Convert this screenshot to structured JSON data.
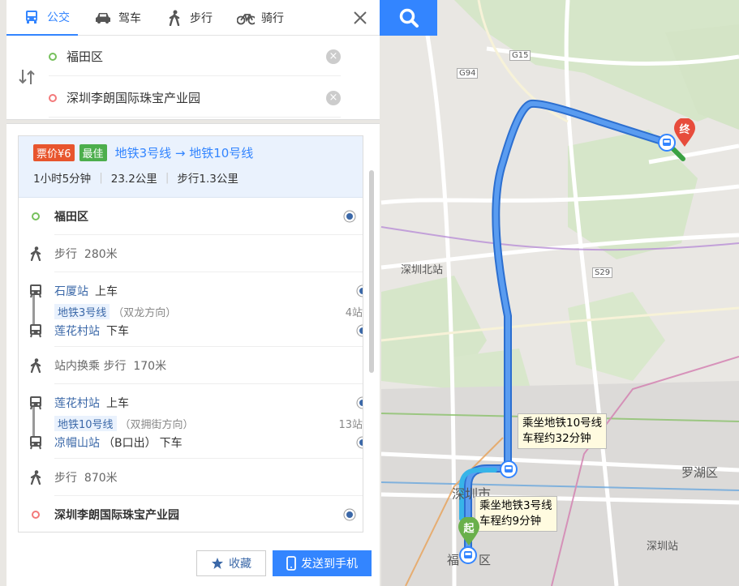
{
  "modes": [
    {
      "label": "公交",
      "icon": "bus-icon",
      "active": true
    },
    {
      "label": "驾车",
      "icon": "car-icon",
      "active": false
    },
    {
      "label": "步行",
      "icon": "walk-icon",
      "active": false
    },
    {
      "label": "骑行",
      "icon": "bike-icon",
      "active": false
    }
  ],
  "inputs": {
    "start": "福田区",
    "end": "深圳李朗国际珠宝产业园"
  },
  "summary": {
    "price_badge": "票价¥6",
    "best_badge": "最佳",
    "title": "地铁3号线 → 地铁10号线",
    "duration": "1小时5分钟",
    "distance": "23.2公里",
    "walk": "步行1.3公里"
  },
  "steps": {
    "start_name": "福田区",
    "walk1": "步行",
    "walk1_dist": "280米",
    "bus1": {
      "board_station": "石厦站",
      "board_action": "上车",
      "line": "地铁3号线",
      "direction": "（双龙方向）",
      "stops": "4站",
      "alight_station": "莲花村站",
      "alight_action": "下车"
    },
    "transfer": "站内换乘",
    "transfer_walk": "步行",
    "transfer_dist": "170米",
    "bus2": {
      "board_station": "莲花村站",
      "board_action": "上车",
      "line": "地铁10号线",
      "direction": "（双拥街方向）",
      "stops": "13站",
      "alight_station": "凉帽山站",
      "alight_exit": "（B口出）",
      "alight_action": "下车"
    },
    "walk2": "步行",
    "walk2_dist": "870米",
    "end_name": "深圳李朗国际珠宝产业园"
  },
  "buttons": {
    "favorite": "收藏",
    "send_phone": "发送到手机"
  },
  "map": {
    "labels": {
      "north_station": "深圳北站",
      "city": "深圳市",
      "luohu": "罗湖区",
      "shenzhen_station": "深圳站",
      "futian_partial": "福",
      "futian_partial2": "区",
      "g15": "G15",
      "g94": "G94",
      "s29": "S29"
    },
    "tip1": [
      "乘坐地铁10号线",
      "车程约32分钟"
    ],
    "tip2": [
      "乘坐地铁3号线",
      "车程约9分钟"
    ],
    "start_marker": "起",
    "end_marker": "终"
  },
  "colors": {
    "accent": "#3385ff",
    "route": "#4f8fe8",
    "route_outline": "#2c6fd0",
    "start_green": "#6ab04c",
    "end_red": "#e74c3c"
  }
}
